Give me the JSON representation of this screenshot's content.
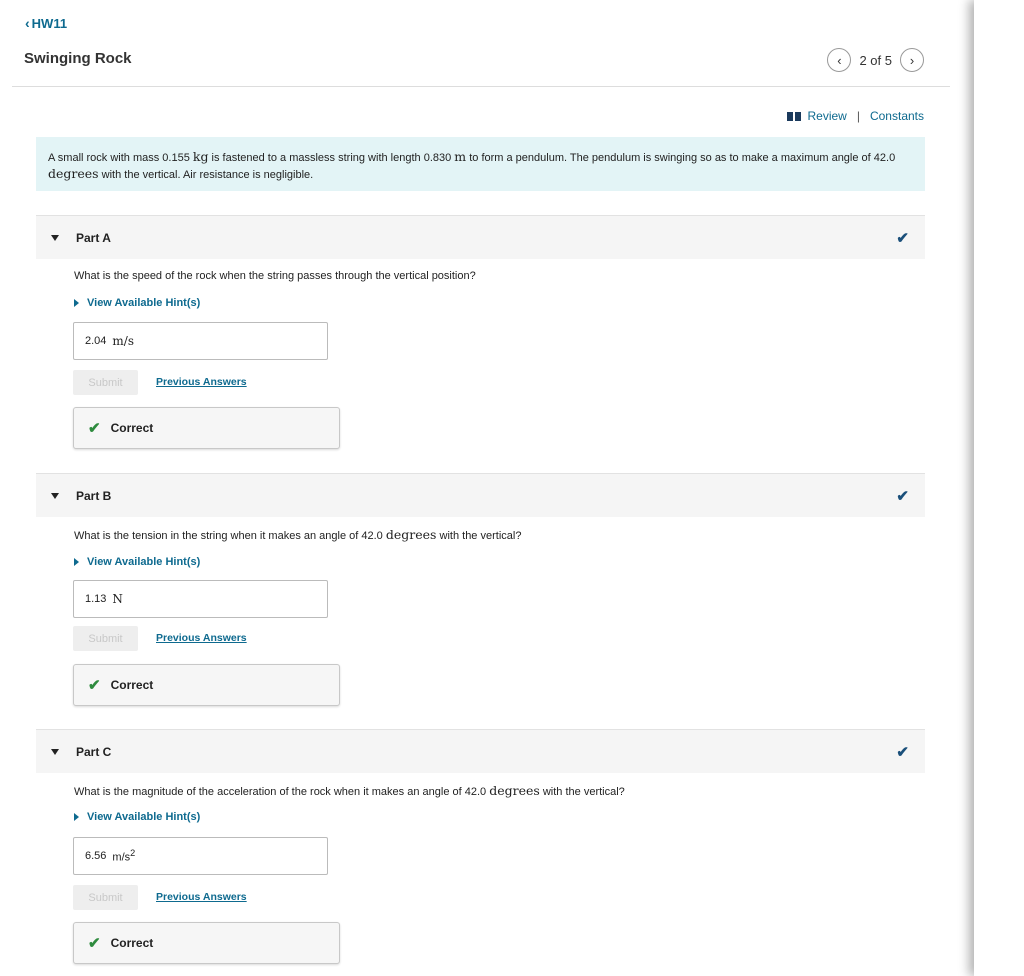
{
  "header": {
    "back_label": "HW11",
    "title": "Swinging Rock",
    "pager_text": "2 of 5"
  },
  "links": {
    "review": "Review",
    "constants": "Constants"
  },
  "problem": {
    "text_1": "A small rock with mass 0.155",
    "unit_1": "kg",
    "text_2": "is fastened to a massless string with length 0.830",
    "unit_2": "m",
    "text_3": "to form a pendulum. The pendulum is swinging so as to make a maximum angle of 42.0",
    "unit_3": "degrees",
    "text_4": "with the vertical. Air resistance is negligible."
  },
  "parts": [
    {
      "label": "Part A",
      "question": "What is the speed of the rock when the string passes through the vertical position?",
      "hint": "View Available Hint(s)",
      "answer_value": "2.04",
      "answer_unit": "m/s",
      "submit": "Submit",
      "previous": "Previous Answers",
      "result": "Correct"
    },
    {
      "label": "Part B",
      "question_1": "What is the tension in the string when it makes an angle of 42.0",
      "question_unit": "degrees",
      "question_2": "with the vertical?",
      "hint": "View Available Hint(s)",
      "answer_value": "1.13",
      "answer_unit": "N",
      "submit": "Submit",
      "previous": "Previous Answers",
      "result": "Correct"
    },
    {
      "label": "Part C",
      "question_1": "What is the magnitude of the acceleration of the rock when it makes an angle of 42.0",
      "question_unit": "degrees",
      "question_2": "with the vertical?",
      "hint": "View Available Hint(s)",
      "answer_value": "6.56",
      "answer_unit": "m/s",
      "answer_exp": "2",
      "submit": "Submit",
      "previous": "Previous Answers",
      "result": "Correct"
    }
  ],
  "colors": {
    "link": "#0e6a8f",
    "problem_bg": "#e3f4f6",
    "check": "#1a4f7a",
    "correct": "#2e8b3e"
  }
}
